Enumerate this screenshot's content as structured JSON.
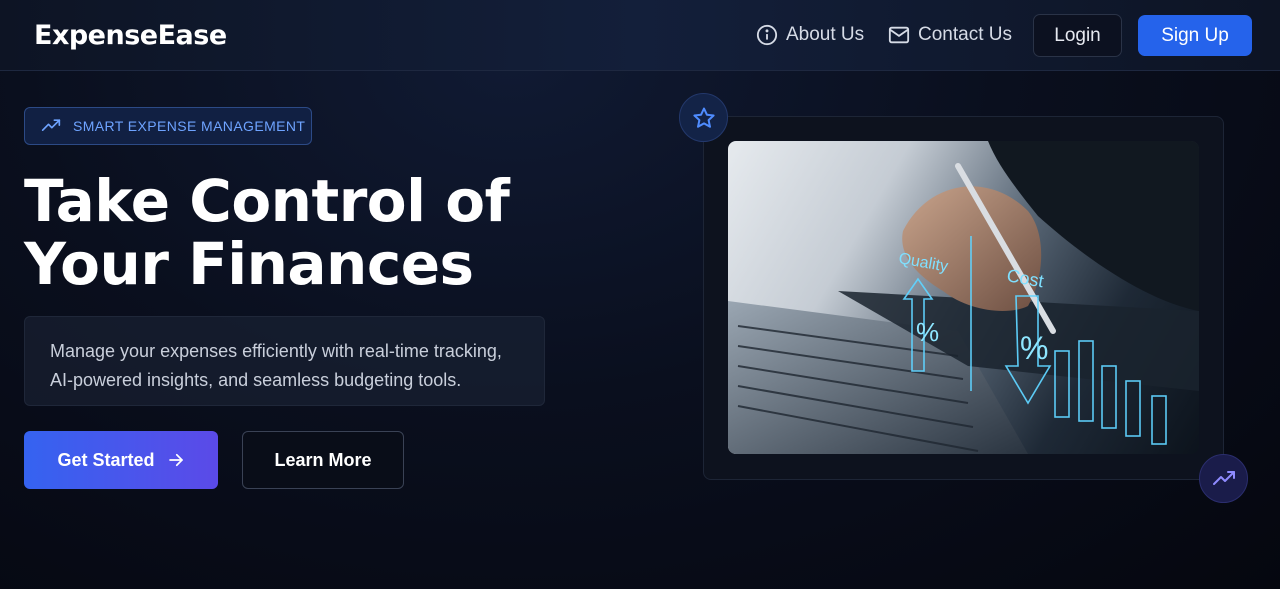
{
  "brand": {
    "name": "ExpenseEase"
  },
  "nav": {
    "about_label": "About Us",
    "contact_label": "Contact Us",
    "login_label": "Login",
    "signup_label": "Sign Up"
  },
  "hero": {
    "badge_label": "SMART EXPENSE MANAGEMENT",
    "headline_line1": "Take Control of",
    "headline_line2": "Your Finances",
    "description_line1": "Manage your expenses efficiently with real-time tracking,",
    "description_line2": "AI-powered insights, and seamless budgeting tools.",
    "primary_cta": "Get Started",
    "secondary_cta": "Learn More"
  },
  "photo": {
    "quality_label": "Quality",
    "cost_label": "Cost",
    "percent_symbol": "%"
  },
  "icons": {
    "about": "info-icon",
    "contact": "mail-icon",
    "badge": "trending-up-icon",
    "cta_arrow": "arrow-right-icon",
    "float_top": "star-icon",
    "float_bottom": "trending-up-icon"
  },
  "colors": {
    "accent": "#2563eb",
    "badge_text": "#6ea3ff",
    "cta_gradient_start": "#3563f0",
    "cta_gradient_end": "#5b4ae8",
    "background": "#0a0f1e"
  }
}
